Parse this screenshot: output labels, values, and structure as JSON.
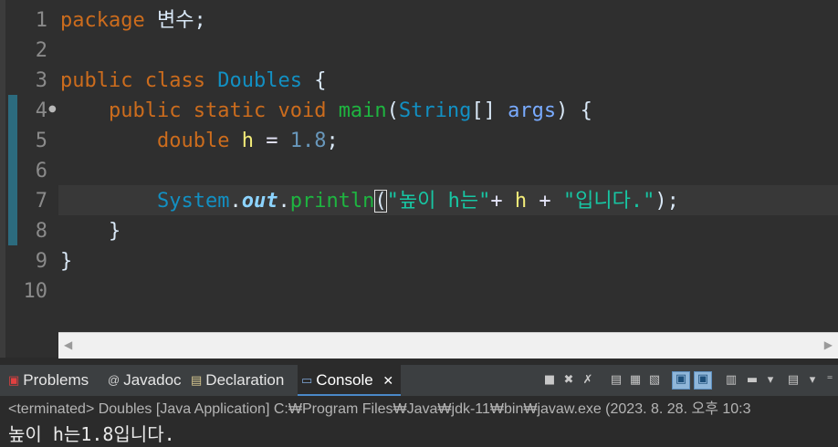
{
  "editor": {
    "line_numbers": [
      "1",
      "2",
      "3",
      "4",
      "5",
      "6",
      "7",
      "8",
      "9",
      "10"
    ],
    "line1": {
      "kw_package": "package",
      "pkg_name": " 변수;"
    },
    "line3": {
      "kw_public": "public",
      "kw_class": "class",
      "class_name": "Doubles",
      "brace": "{"
    },
    "line4": {
      "kw_public": "public",
      "kw_static": "static",
      "kw_void": "void",
      "method": "main",
      "paren_open": "(",
      "type": "String",
      "arr": "[]",
      "param": "args",
      "close": ")",
      "brace": "{"
    },
    "line5": {
      "kw_double": "double",
      "var": "h",
      "eq": "=",
      "value": "1.8",
      "semi": ";"
    },
    "line7": {
      "cls": "System",
      "dot1": ".",
      "field": "out",
      "dot2": ".",
      "method": "println",
      "paren": "(",
      "str1": "\"높이 h는\"",
      "plus1": "+",
      "var": "h",
      "plus2": "+",
      "str2": "\"입니다.\"",
      "end": ");"
    },
    "line8": {
      "brace": "}"
    },
    "line9": {
      "brace": "}"
    }
  },
  "console_view": {
    "tabs": [
      {
        "label": "Problems",
        "icon": "problems-icon"
      },
      {
        "label": "Javadoc",
        "icon": "at-icon"
      },
      {
        "label": "Declaration",
        "icon": "declaration-icon"
      },
      {
        "label": "Console",
        "icon": "console-icon",
        "close": "✕"
      }
    ],
    "terminated_text": "<terminated> Doubles [Java Application] C:₩Program Files₩Java₩jdk-11₩bin₩javaw.exe  (2023. 8. 28. 오후 10:3",
    "output": "높이 h는1.8입니다."
  },
  "colors": {
    "keyword": "#cc6c1d",
    "class": "#1290c3",
    "method": "#1eb540",
    "string": "#17c6a3",
    "variable": "#f3ec79",
    "number": "#6897bb"
  }
}
